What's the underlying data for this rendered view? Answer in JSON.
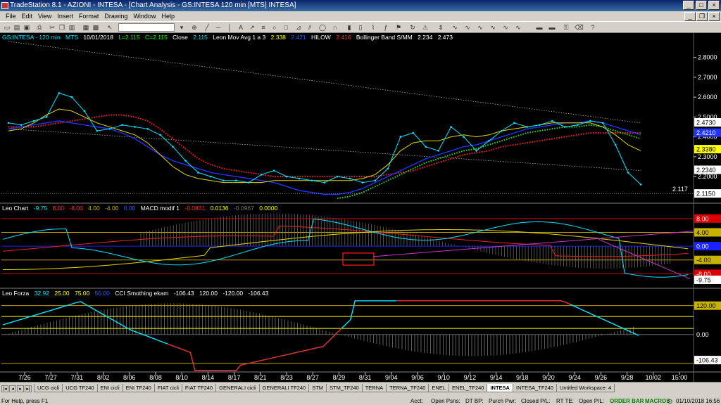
{
  "window": {
    "title": "TradeStation 8.1 - AZIONI - INTESA - [Chart Analysis - GS:INTESA  120 min  [MTS] INTESA]",
    "minimize": "_",
    "maximize": "□",
    "close": "×"
  },
  "menu": [
    "File",
    "Edit",
    "View",
    "Insert",
    "Format",
    "Drawing",
    "Window",
    "Help"
  ],
  "toolbar": {
    "symbol_value": ""
  },
  "price_header": {
    "symbol": "GS:INTESA - 120 min",
    "data": "MTS",
    "date": "10/01/2018",
    "low": "L=2.115",
    "close_val": "C=2.115",
    "close_label": "Close",
    "close_num": "2.115",
    "mov_label": "Leon Mov Avg 1 a 3",
    "mov_v1": "2.338",
    "mov_v2": "2.421",
    "hilow_label": "HILOW",
    "hilow_val": "2.416",
    "boll_label": "Bollinger Band S/MM",
    "boll_v1": "2.234",
    "boll_v2": "2.473"
  },
  "leo_chart_header": {
    "name": "Leo Chart",
    "v1": "-9.75",
    "v2": "8.00",
    "v3": "-8.00",
    "v4": "4.00",
    "v5": "-4.00",
    "v6": "0.00",
    "macd_label": "MACD modif 1",
    "m1": "-0.0831",
    "m2": "0.0136",
    "m3": "-0.0967",
    "m4": "0.0000"
  },
  "leo_forza_header": {
    "name": "Leo Forza",
    "v1": "32.92",
    "v2": "25.00",
    "v3": "75.00",
    "v4": "50.00",
    "cci_label": "CCI Smothing ekam",
    "c1": "-106.43",
    "c2": "120.00",
    "c3": "-120.00",
    "c4": "-106.43"
  },
  "price_axis": {
    "ticks": [
      2.8,
      2.7,
      2.6,
      2.5,
      2.4,
      2.3,
      2.2
    ],
    "min": 2.08,
    "max": 2.88,
    "last_price_label": "2.117",
    "badges": [
      {
        "text": "2.4730",
        "bg": "#ffffff",
        "fg": "#000000",
        "value": 2.473
      },
      {
        "text": "2.4210",
        "bg": "#2233ff",
        "fg": "#ffffff",
        "value": 2.421
      },
      {
        "text": "2.3380",
        "bg": "#ffff00",
        "fg": "#000000",
        "value": 2.338
      },
      {
        "text": "2.2340",
        "bg": "#ffffff",
        "fg": "#000000",
        "value": 2.234
      },
      {
        "text": "2.1150",
        "bg": "#ffffff",
        "fg": "#000000",
        "value": 2.115
      }
    ]
  },
  "leo_chart_axis": {
    "badges": [
      {
        "text": "8.00",
        "bg": "#dd0000",
        "fg": "#ffffff",
        "value": 8
      },
      {
        "text": "4.00",
        "bg": "#c8b400",
        "fg": "#000000",
        "value": 4
      },
      {
        "text": "0.00",
        "bg": "#1a22ff",
        "fg": "#ffffff",
        "value": 0
      },
      {
        "text": "-4.00",
        "bg": "#c8b400",
        "fg": "#000000",
        "value": -4
      },
      {
        "text": "-8.00",
        "bg": "#dd0000",
        "fg": "#ffffff",
        "value": -8
      },
      {
        "text": "-9.75",
        "bg": "#ffffff",
        "fg": "#000000",
        "value": -9.75
      }
    ]
  },
  "leo_forza_axis": {
    "badges": [
      {
        "text": "120.00",
        "bg": "#c8b400",
        "fg": "#000000",
        "value": 120
      },
      {
        "text": "0.00",
        "bg": "#000000",
        "fg": "#ffffff",
        "value": 0
      },
      {
        "text": "-106.43",
        "bg": "#ffffff",
        "fg": "#000000",
        "value": -106.43
      }
    ]
  },
  "time_axis": [
    "7/26",
    "7/27",
    "7/31",
    "8/02",
    "8/06",
    "8/08",
    "8/10",
    "8/14",
    "8/17",
    "8/21",
    "8/23",
    "8/27",
    "8/29",
    "8/31",
    "9/04",
    "9/06",
    "9/10",
    "9/12",
    "9/14",
    "9/18",
    "9/20",
    "9/24",
    "9/26",
    "9/28",
    "10/02",
    "15:00"
  ],
  "chart_data": {
    "type": "line",
    "panels": [
      {
        "name": "price",
        "series": [
          {
            "name": "Close",
            "color": "#00e5ff",
            "values": [
              2.47,
              2.46,
              2.48,
              2.5,
              2.62,
              2.6,
              2.53,
              2.43,
              2.44,
              2.46,
              2.45,
              2.44,
              2.41,
              2.35,
              2.28,
              2.22,
              2.2,
              2.18,
              2.18,
              2.17,
              2.21,
              2.23,
              2.2,
              2.19,
              2.18,
              2.17,
              2.2,
              2.19,
              2.17,
              2.18,
              2.24,
              2.4,
              2.42,
              2.35,
              2.33,
              2.45,
              2.4,
              2.33,
              2.38,
              2.43,
              2.47,
              2.45,
              2.46,
              2.48,
              2.45,
              2.46,
              2.48,
              2.47,
              2.36,
              2.22,
              2.16
            ]
          },
          {
            "name": "Leon Mov Avg 1",
            "color": "#2233ff",
            "values": [
              2.44,
              2.45,
              2.46,
              2.47,
              2.48,
              2.47,
              2.46,
              2.45,
              2.44,
              2.42,
              2.39,
              2.35,
              2.31,
              2.28,
              2.26,
              2.24,
              2.22,
              2.21,
              2.2,
              2.19,
              2.18,
              2.17,
              2.15,
              2.13,
              2.12,
              2.11,
              2.11,
              2.12,
              2.14,
              2.17,
              2.2,
              2.23,
              2.26,
              2.29,
              2.31,
              2.33,
              2.35,
              2.36,
              2.38,
              2.4,
              2.42,
              2.44,
              2.45,
              2.46,
              2.47,
              2.47,
              2.48,
              2.47,
              2.45,
              2.43,
              2.41
            ]
          },
          {
            "name": "Leon Mov Avg 3",
            "color": "#e5d600",
            "values": [
              2.43,
              2.44,
              2.47,
              2.51,
              2.54,
              2.53,
              2.5,
              2.47,
              2.45,
              2.43,
              2.41,
              2.37,
              2.31,
              2.25,
              2.21,
              2.19,
              2.18,
              2.17,
              2.17,
              2.17,
              2.17,
              2.18,
              2.18,
              2.18,
              2.18,
              2.18,
              2.18,
              2.18,
              2.19,
              2.21,
              2.26,
              2.33,
              2.37,
              2.38,
              2.38,
              2.4,
              2.41,
              2.4,
              2.41,
              2.43,
              2.44,
              2.45,
              2.46,
              2.47,
              2.47,
              2.47,
              2.47,
              2.45,
              2.41,
              2.36,
              2.33
            ]
          },
          {
            "name": "HILOW",
            "color": "#ff2020",
            "values": [
              2.45,
              2.45,
              2.45,
              2.46,
              2.47,
              2.48,
              2.49,
              2.5,
              2.51,
              2.51,
              2.5,
              2.48,
              2.44,
              2.39,
              2.34,
              2.29,
              2.26,
              2.24,
              2.23,
              2.22,
              2.21,
              2.2,
              2.2,
              2.2,
              2.2,
              2.2,
              2.2,
              2.2,
              2.2,
              2.2,
              2.21,
              2.22,
              2.23,
              2.25,
              2.27,
              2.29,
              2.31,
              2.32,
              2.33,
              2.35,
              2.36,
              2.37,
              2.38,
              2.39,
              2.4,
              2.41,
              2.42,
              2.42,
              2.42,
              2.42,
              2.42
            ]
          }
        ]
      }
    ]
  }
}
